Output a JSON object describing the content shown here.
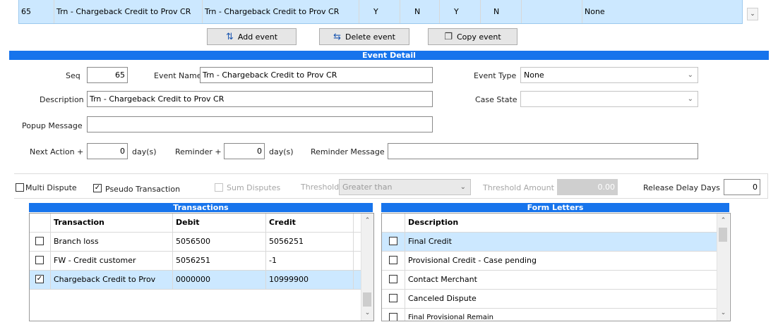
{
  "top_row": {
    "cells": [
      "65",
      "Trn - Chargeback Credit to Prov CR",
      "Trn - Chargeback Credit to Prov CR",
      "Y",
      "N",
      "Y",
      "N",
      "",
      "None"
    ]
  },
  "actions": {
    "add_label": "Add event",
    "delete_label": "Delete event",
    "copy_label": "Copy event"
  },
  "event_detail": {
    "title": "Event Detail",
    "seq_label": "Seq",
    "seq_value": "65",
    "event_name_label": "Event Name",
    "event_name_value": "Trn - Chargeback Credit to Prov CR",
    "event_type_label": "Event Type",
    "event_type_value": "None",
    "description_label": "Description",
    "description_value": "Trn - Chargeback Credit to Prov CR",
    "case_state_label": "Case State",
    "case_state_value": "",
    "popup_label": "Popup Message",
    "popup_value": "",
    "next_action_label": "Next Action +",
    "next_action_value": "0",
    "days_unit": "day(s)",
    "reminder_label": "Reminder +",
    "reminder_value": "0",
    "reminder_message_label": "Reminder Message",
    "reminder_message_value": ""
  },
  "options": {
    "multi_dispute_label": "Multi Dispute",
    "multi_dispute_checked": false,
    "pseudo_transaction_label": "Pseudo Transaction",
    "pseudo_transaction_checked": true,
    "sum_disputes_label": "Sum Disputes",
    "threshold_label": "Threshold",
    "threshold_value": "Greater than",
    "threshold_amount_label": "Threshold Amount",
    "threshold_amount_value": "0.00",
    "release_delay_label": "Release Delay Days",
    "release_delay_value": "0"
  },
  "transactions": {
    "title": "Transactions",
    "headers": [
      "Transaction",
      "Debit",
      "Credit"
    ],
    "rows": [
      {
        "checked": false,
        "transaction": "Branch loss",
        "debit": "5056500",
        "credit": "5056251"
      },
      {
        "checked": false,
        "transaction": "FW - Credit customer",
        "debit": "5056251",
        "credit": "-1"
      },
      {
        "checked": true,
        "transaction": "Chargeback Credit to Prov",
        "debit": "0000000",
        "credit": "10999900"
      }
    ]
  },
  "form_letters": {
    "title": "Form Letters",
    "headers": [
      "Description"
    ],
    "rows": [
      {
        "checked": false,
        "description": "Final Credit"
      },
      {
        "checked": false,
        "description": "Provisional Credit - Case pending"
      },
      {
        "checked": false,
        "description": "Contact Merchant"
      },
      {
        "checked": false,
        "description": "Canceled Dispute"
      },
      {
        "checked": false,
        "description": "Final Provisional Remain"
      }
    ]
  },
  "colors": {
    "accent_bar": "#1774ec",
    "selected_row": "#cce8ff"
  }
}
